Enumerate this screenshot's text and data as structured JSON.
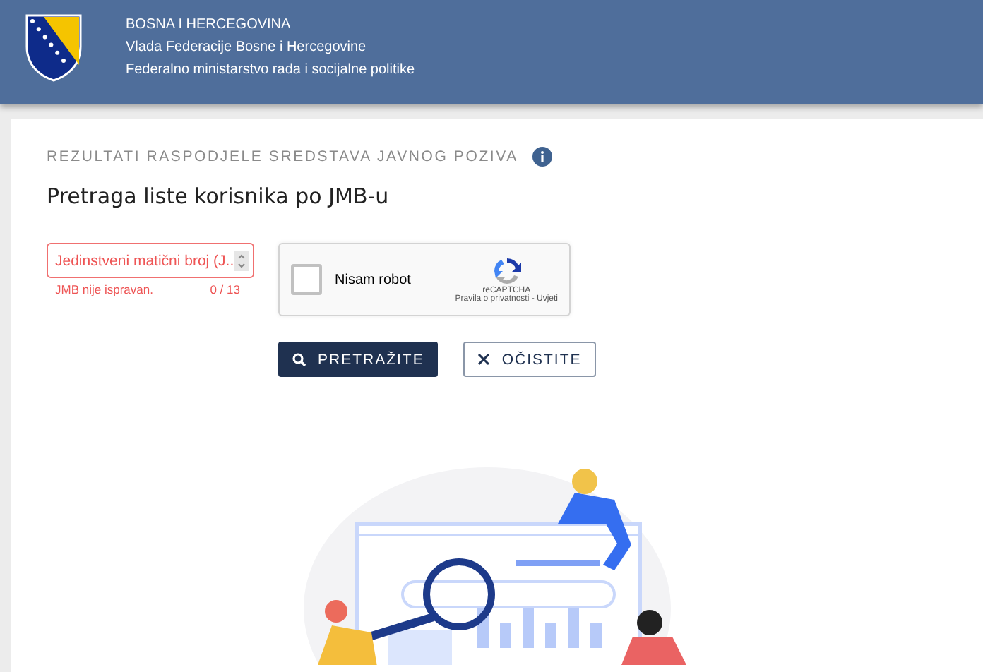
{
  "header": {
    "lines": [
      "BOSNA I HERCEGOVINA",
      "Vlada Federacije Bosne i Hercegovine",
      "Federalno ministarstvo rada i socijalne politike"
    ]
  },
  "section_title": "REZULTATI RASPODJELE SREDSTAVA JAVNOG POZIVA",
  "heading": "Pretraga liste korisnika po JMB-u",
  "jmb_field": {
    "placeholder": "Jedinstveni matični broj (J...",
    "error": "JMB nije ispravan.",
    "counter": "0 / 13",
    "invalid": true
  },
  "captcha": {
    "label": "Nisam robot",
    "checked": false,
    "brand": "reCAPTCHA",
    "links": "Pravila o privatnosti - Uvjeti"
  },
  "buttons": [
    {
      "label": "PRETRAŽITE",
      "kind": "primary"
    },
    {
      "label": "OČISTITE",
      "kind": "outline"
    }
  ]
}
